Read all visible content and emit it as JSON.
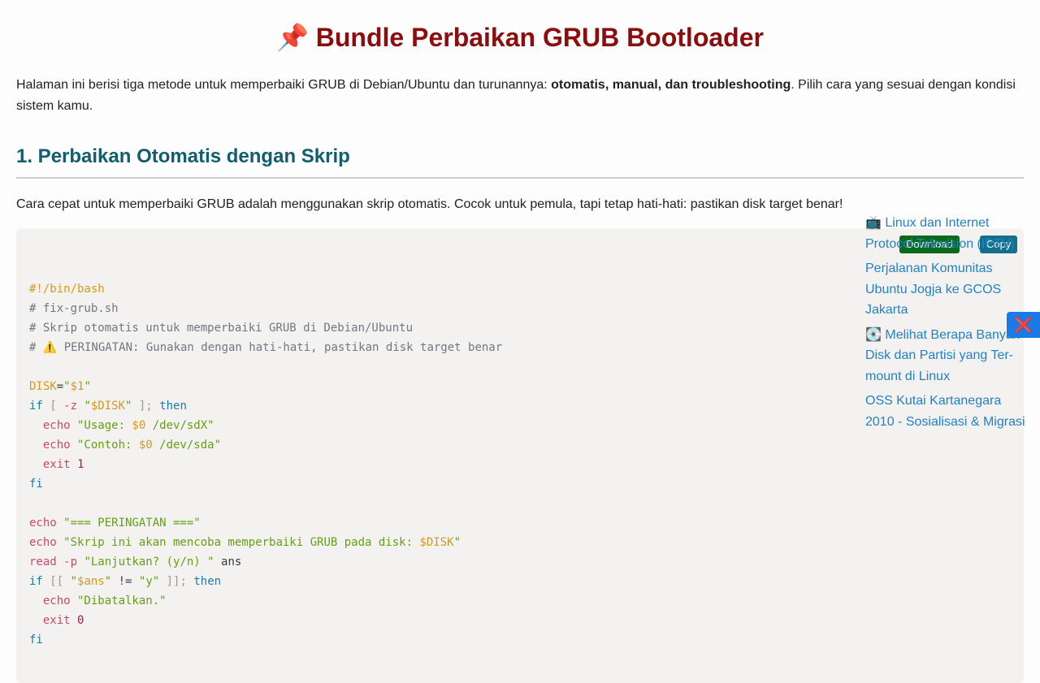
{
  "page": {
    "title": "📌 Bundle Perbaikan GRUB Bootloader",
    "intro_before": "Halaman ini berisi tiga metode untuk memperbaiki GRUB di Debian/Ubuntu dan turunannya: ",
    "intro_bold": "otomatis, manual, dan troubleshooting",
    "intro_after": ". Pilih cara yang sesuai dengan kondisi sistem kamu.",
    "section1_heading": "1. Perbaikan Otomatis dengan Skrip",
    "section1_lead": "Cara cepat untuk memperbaiki GRUB adalah menggunakan skrip otomatis. Cocok untuk pemula, tapi tetap hati-hati: pastikan disk target benar!"
  },
  "code_toolbar": {
    "download_label": "Download",
    "copy_label": "Copy"
  },
  "code": {
    "l1": "#!/bin/bash",
    "l2": "# fix-grub.sh",
    "l3": "# Skrip otomatis untuk memperbaiki GRUB di Debian/Ubuntu",
    "l4": "# ⚠️ PERINGATAN: Gunakan dengan hati-hati, pastikan disk target benar",
    "disk_var": "DISK",
    "disk_eq": "=",
    "disk_val_q1": "\"",
    "disk_val": "$1",
    "disk_val_q2": "\"",
    "if": "if",
    "br_open": " [ ",
    "flag_z": "-z",
    "q_open": " \"",
    "disk_ref": "$DISK",
    "q_close": "\"",
    "br_close": " ];",
    "then": " then",
    "echo": "echo",
    "usage_str_a": " \"Usage: ",
    "dollar0": "$0",
    "usage_str_b": " /dev/sdX\"",
    "contoh_str_a": " \"Contoh: ",
    "contoh_str_b": " /dev/sda\"",
    "exit": "exit",
    "one": " 1",
    "fi": "fi",
    "peringatan_str": " \"=== PERINGATAN ===\"",
    "skrip_str_a": " \"Skrip ini akan mencoba memperbaiki GRUB pada disk: ",
    "skrip_str_b": "\"",
    "read": "read",
    "flag_p": " -p",
    "lanjut_str": " \"Lanjutkan? (y/n) \"",
    "ans": " ans",
    "dbr_open": " [[ ",
    "ans_q_open": "\"",
    "ans_ref": "$ans",
    "ans_q_close": "\"",
    "neq": " != ",
    "y_str": "\"y\"",
    "dbr_close": " ]];",
    "batal_str": " \"Dibatalkan.\"",
    "zero": " 0"
  },
  "related_links": [
    "📺 Linux dan Internet Protocol Television (IPTV)",
    "Perjalanan Komunitas Ubuntu Jogja ke GCOS Jakarta",
    "💽 Melihat Berapa Banyak Disk dan Partisi yang Ter-mount di Linux",
    "OSS Kutai Kartanegara 2010 - Sosialisasi & Migrasi"
  ],
  "close_icon": "❌",
  "colors": {
    "title": "#8b0d0d",
    "heading": "#105e6e",
    "link": "#2381c4",
    "download_btn": "#0b6b1a",
    "copy_btn": "#12708c",
    "close_bg": "#1a7ae6"
  }
}
